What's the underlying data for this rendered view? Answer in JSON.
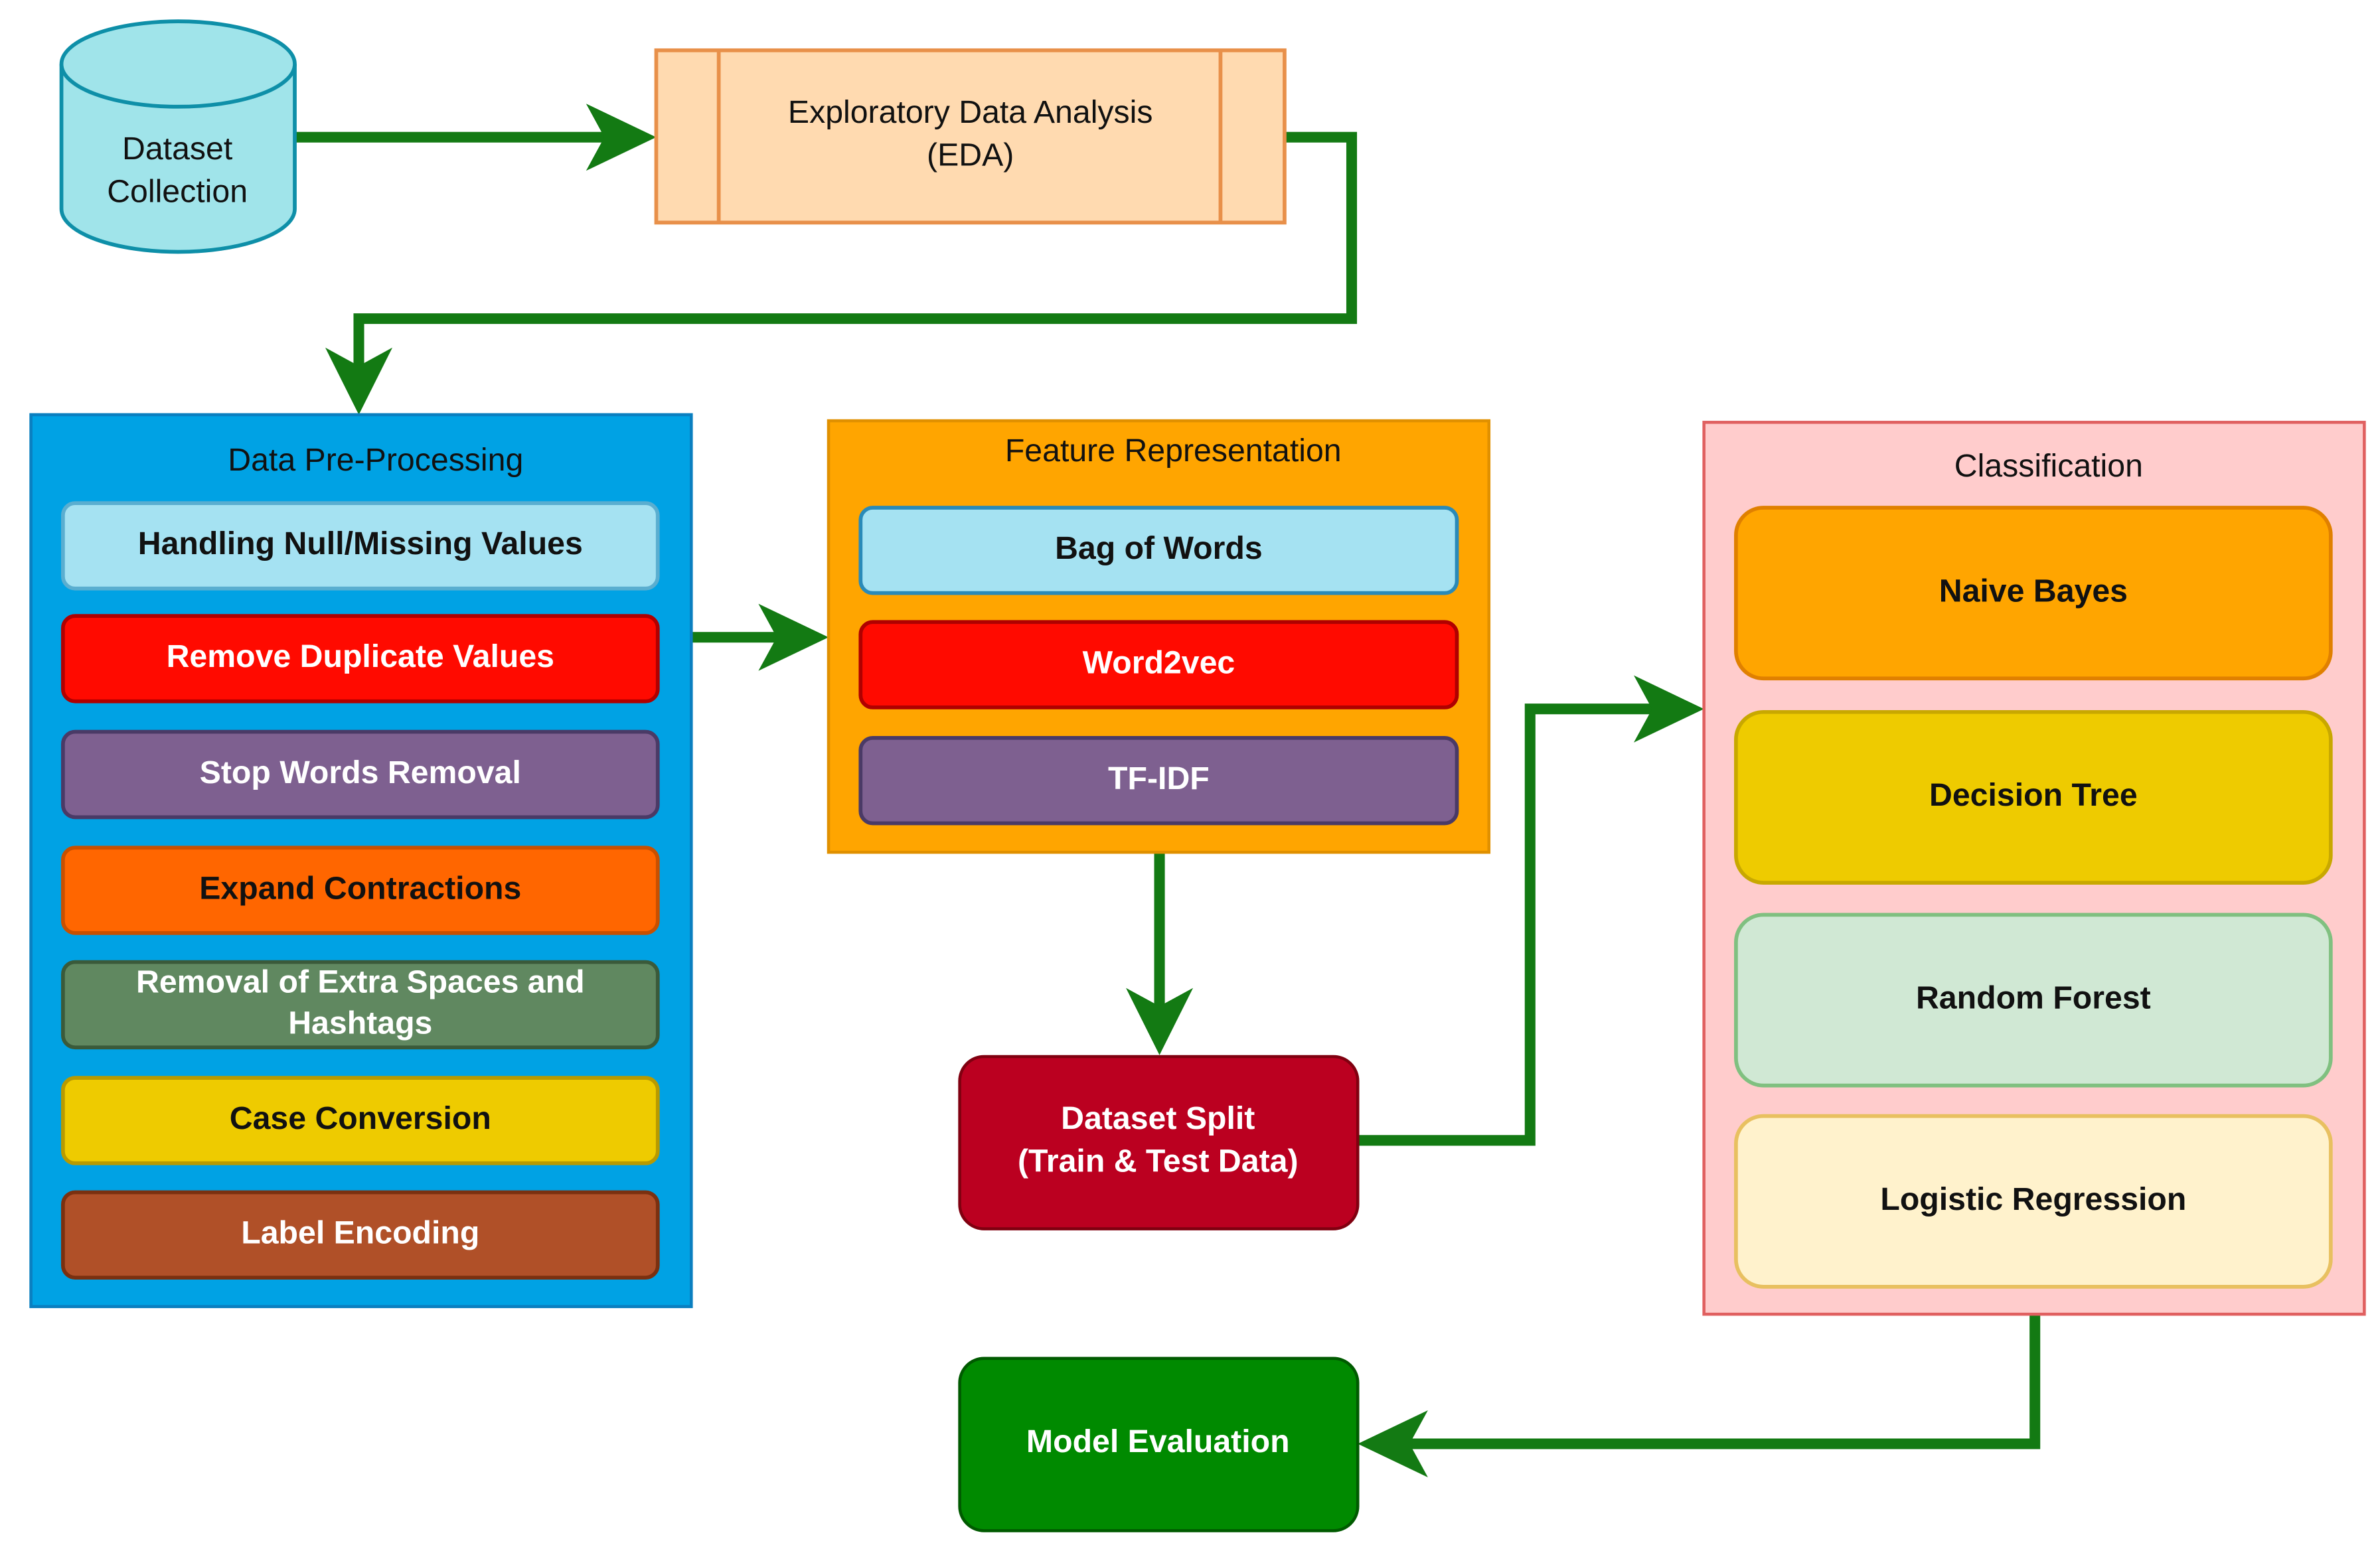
{
  "colors": {
    "arrow": "#137a13",
    "cylinder": "#a0e4ea",
    "eda": "#ffdab0",
    "preprocessing_container": "#00a2e4",
    "feature_container": "#ffa500",
    "classification_container": "#ffcccc",
    "dataset_split": "#bb0020",
    "model_evaluation": "#008a00"
  },
  "nodes": {
    "dataset_collection": [
      "Dataset",
      "Collection"
    ],
    "eda": [
      "Exploratory Data Analysis",
      "(EDA)"
    ],
    "dataset_split": [
      "Dataset Split",
      "(Train & Test Data)"
    ],
    "model_evaluation": "Model Evaluation"
  },
  "preprocessing": {
    "title": "Data Pre-Processing",
    "items": [
      {
        "label": [
          "Handling Null/Missing Values"
        ],
        "fill": "#a5e2f2",
        "stroke": "#5aaed0",
        "text": "#111111"
      },
      {
        "label": [
          "Remove Duplicate Values"
        ],
        "fill": "#ff0a00",
        "stroke": "#b00000",
        "text": "#ffffff"
      },
      {
        "label": [
          "Stop Words Removal"
        ],
        "fill": "#7e6090",
        "stroke": "#4a3a66",
        "text": "#ffffff"
      },
      {
        "label": [
          "Expand Contractions"
        ],
        "fill": "#ff6600",
        "stroke": "#c85000",
        "text": "#111111"
      },
      {
        "label": [
          "Removal of Extra Spaces and",
          "Hashtags"
        ],
        "fill": "#608860",
        "stroke": "#3a5a3a",
        "text": "#ffffff"
      },
      {
        "label": [
          "Case Conversion"
        ],
        "fill": "#eecb00",
        "stroke": "#b89a00",
        "text": "#111111"
      },
      {
        "label": [
          "Label Encoding"
        ],
        "fill": "#b05028",
        "stroke": "#7a3010",
        "text": "#ffffff"
      }
    ]
  },
  "feature_representation": {
    "title": "Feature Representation",
    "items": [
      {
        "label": [
          "Bag of Words"
        ],
        "fill": "#a5e2f2",
        "stroke": "#2a8ab8",
        "text": "#111111"
      },
      {
        "label": [
          "Word2vec"
        ],
        "fill": "#ff0a00",
        "stroke": "#b00000",
        "text": "#ffffff"
      },
      {
        "label": [
          "TF-IDF"
        ],
        "fill": "#7e6090",
        "stroke": "#4a3a66",
        "text": "#ffffff"
      }
    ]
  },
  "classification": {
    "title": "Classification",
    "items": [
      {
        "label": [
          "Naive Bayes"
        ],
        "fill": "#ffa500",
        "stroke": "#e08000",
        "text": "#111111"
      },
      {
        "label": [
          "Decision Tree"
        ],
        "fill": "#eecb00",
        "stroke": "#c8a800",
        "text": "#111111"
      },
      {
        "label": [
          "Random Forest"
        ],
        "fill": "#d0e8d4",
        "stroke": "#80c080",
        "text": "#111111"
      },
      {
        "label": [
          "Logistic Regression"
        ],
        "fill": "#fff2cc",
        "stroke": "#e8c060",
        "text": "#111111"
      }
    ]
  }
}
